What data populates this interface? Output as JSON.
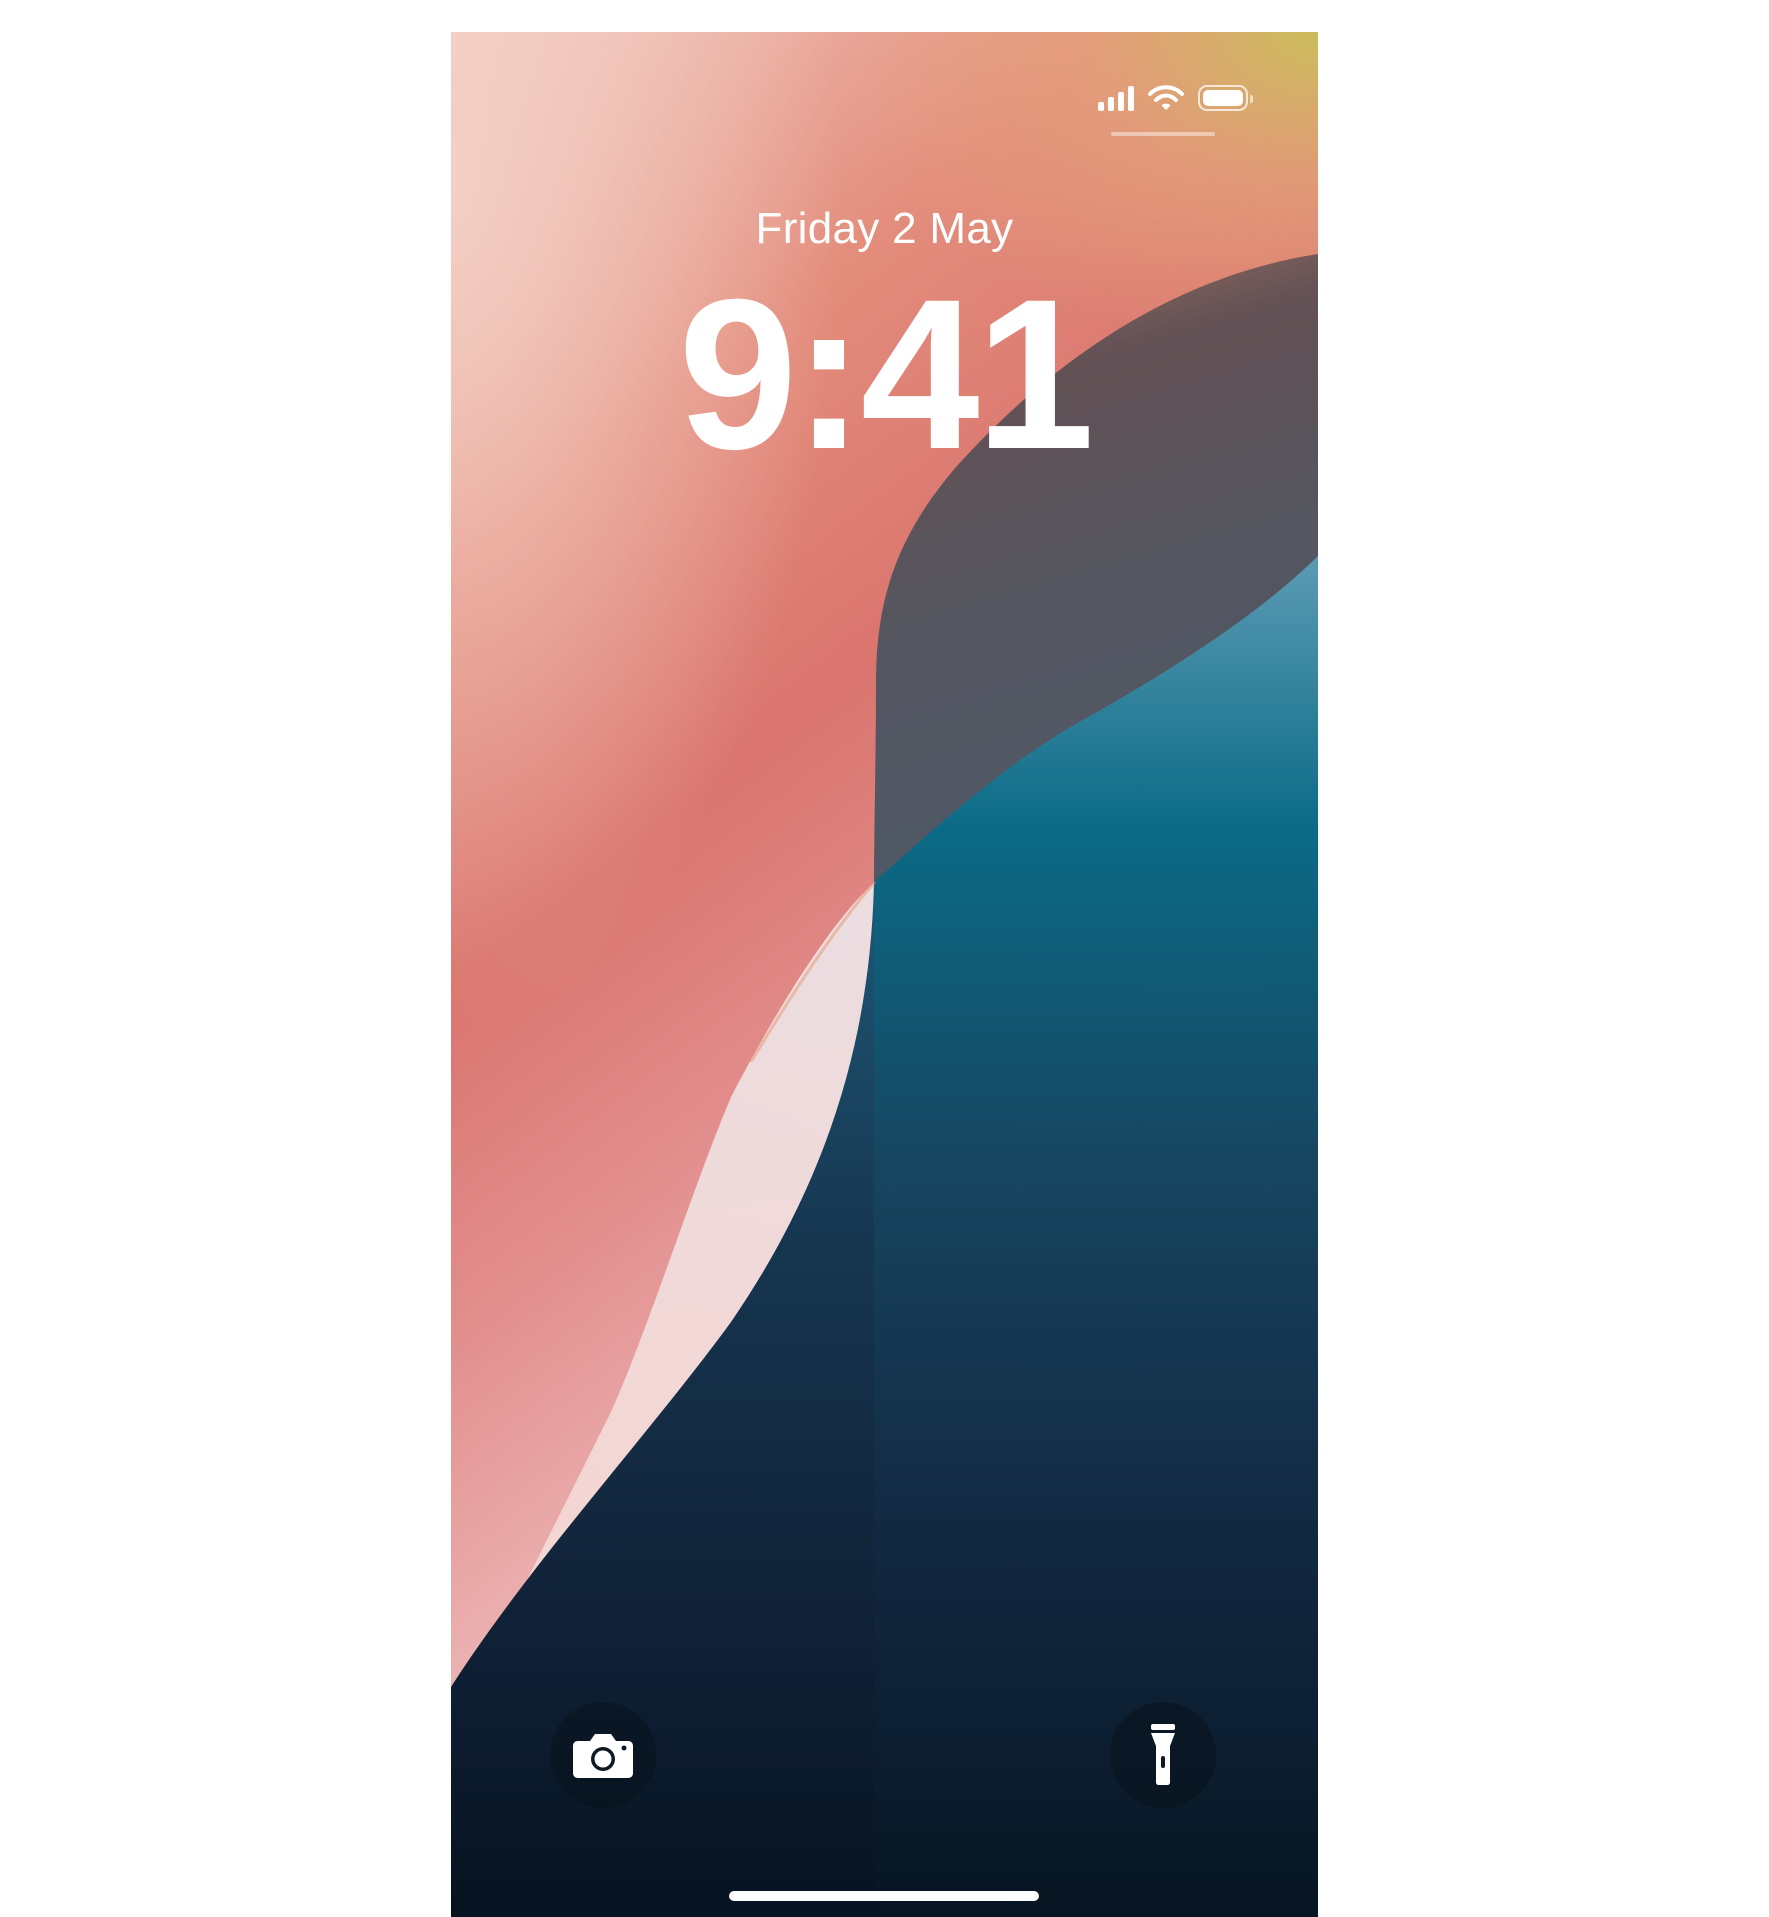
{
  "lockscreen": {
    "date": "Friday 2 May",
    "time": "9:41"
  },
  "status_bar": {
    "signal": "cellular-signal-icon",
    "wifi": "wifi-icon",
    "battery": "battery-full-icon"
  },
  "quick_actions": {
    "left": "camera-icon",
    "right": "flashlight-icon"
  },
  "colors": {
    "background": "#ffffff",
    "wallpaper_pink": "#dc7670",
    "wallpaper_yellow": "#cbbd5b",
    "wallpaper_blue": "#0b6b86",
    "wallpaper_navy": "#0a1626",
    "text": "#ffffff"
  }
}
